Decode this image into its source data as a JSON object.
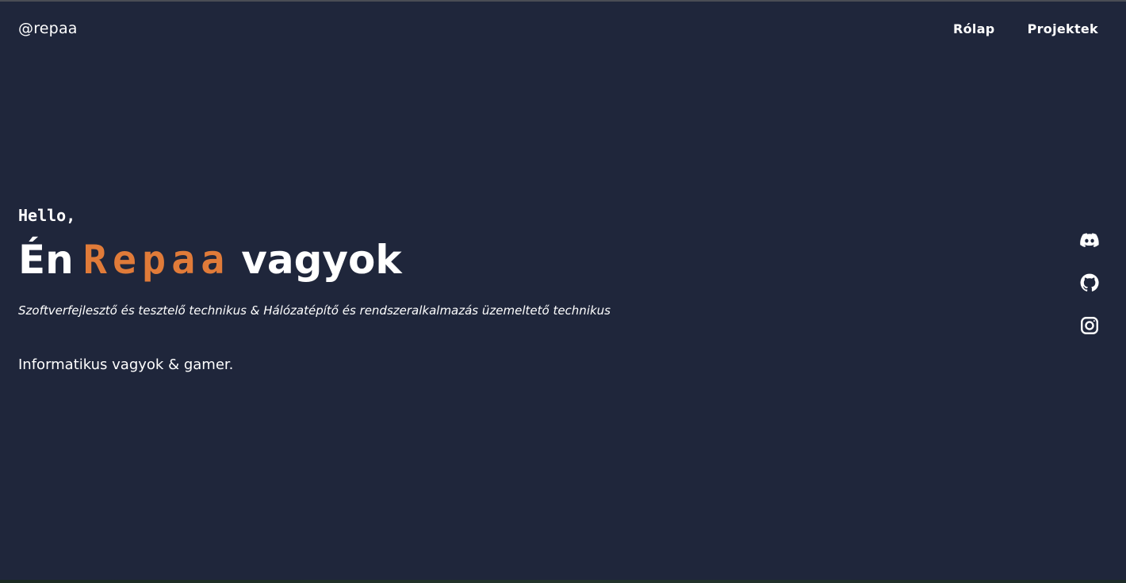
{
  "header": {
    "brand": "@repaa",
    "nav": [
      {
        "label": "Rólap"
      },
      {
        "label": "Projektek"
      }
    ]
  },
  "hero": {
    "greeting": "Hello,",
    "title_prefix": "Én",
    "name": "Repaa",
    "title_suffix": "vagyok",
    "subtitle": "Szoftverfejlesztő és tesztelő technikus & Hálózatépítő és rendszeralkalmazás üzemeltető technikus",
    "about": "Informatikus vagyok & gamer."
  },
  "socials": [
    {
      "icon": "discord-icon"
    },
    {
      "icon": "github-icon"
    },
    {
      "icon": "instagram-icon"
    }
  ],
  "colors": {
    "background": "#1f263b",
    "text": "#ffffff",
    "accent": "#e07b39"
  }
}
